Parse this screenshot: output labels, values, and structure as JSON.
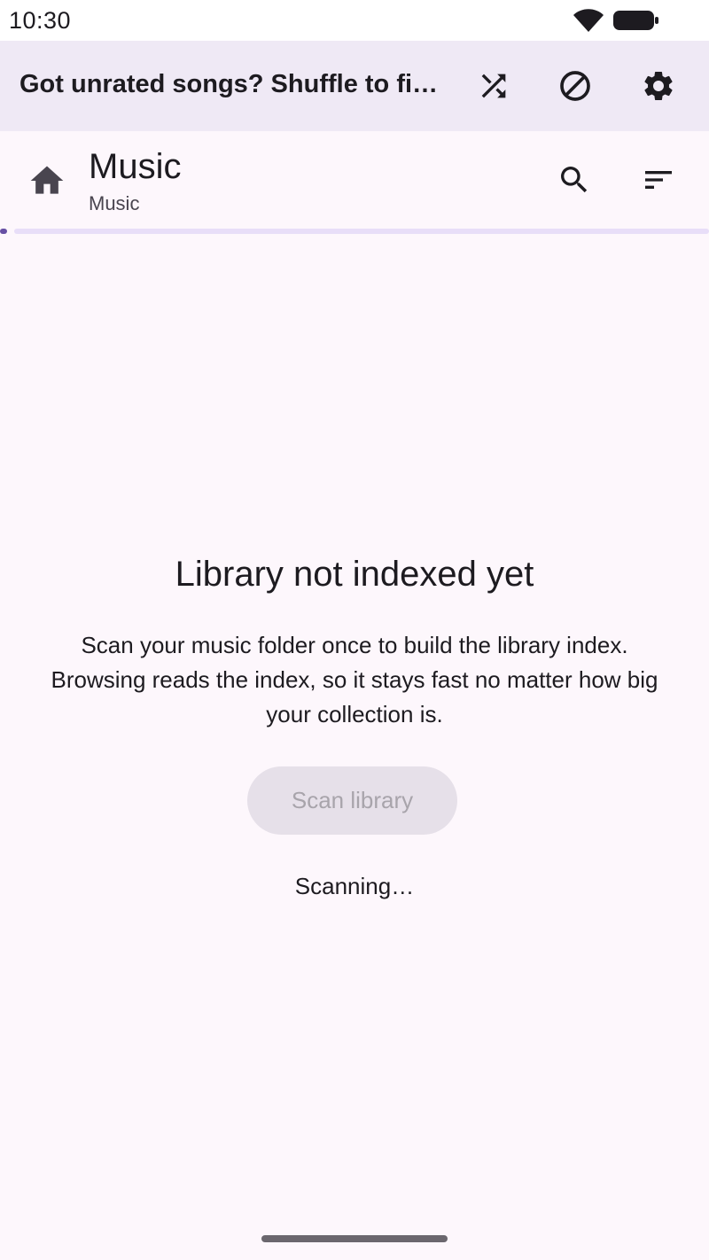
{
  "status_bar": {
    "time": "10:30",
    "icons": [
      "wifi-icon",
      "battery-icon"
    ]
  },
  "banner": {
    "text": "Got unrated songs? Shuffle to find and rate them",
    "actions": [
      "shuffle-icon",
      "block-icon",
      "gear-icon"
    ]
  },
  "toolbar": {
    "title": "Music",
    "subtitle": "Music",
    "icons": [
      "home-icon",
      "search-icon",
      "sort-icon"
    ]
  },
  "progress": {
    "value": 0.01,
    "color": "#6750a4",
    "track_color": "#e8def8"
  },
  "empty_state": {
    "title": "Library not indexed yet",
    "body": "Scan your music folder once to build the library index. Browsing reads the index, so it stays fast no matter how big your collection is.",
    "button_label": "Scan library",
    "button_enabled": false,
    "status": "Scanning…"
  },
  "colors": {
    "background": "#fdf7fc",
    "banner": "#efe9f5",
    "accent": "#6750a4"
  }
}
